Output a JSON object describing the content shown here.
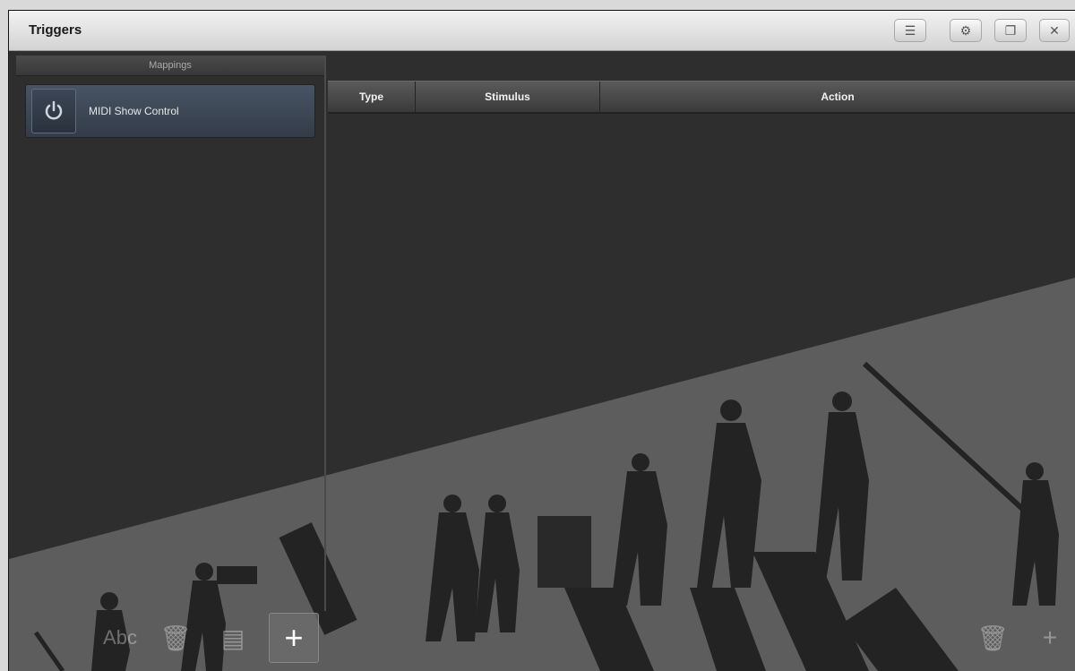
{
  "window": {
    "title": "Triggers"
  },
  "titlebar_buttons": [
    {
      "name": "menu-icon",
      "glyph": "☰"
    },
    {
      "name": "settings-icon",
      "glyph": "⚙"
    },
    {
      "name": "restore-icon",
      "glyph": "❐"
    },
    {
      "name": "close-icon",
      "glyph": "✕"
    }
  ],
  "mappings": {
    "header": "Mappings",
    "items": [
      {
        "label": "MIDI Show Control",
        "icon": "power-icon"
      }
    ]
  },
  "table": {
    "columns": [
      "Type",
      "Stimulus",
      "Action"
    ],
    "rows": []
  },
  "toolbar": {
    "rename_label": "Abc",
    "delete_glyph": "🗑",
    "properties_glyph": "▤",
    "add_glyph": "+",
    "right_delete_glyph": "🗑",
    "right_add_glyph": "+"
  },
  "colors": {
    "background": "#2e2e2e",
    "highlight": "#3d4756"
  }
}
